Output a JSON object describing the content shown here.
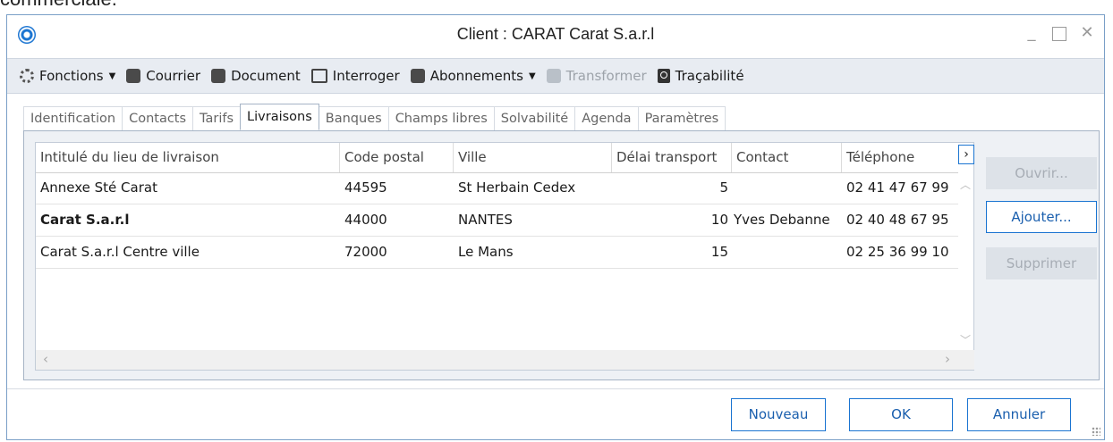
{
  "background_text": "commerciale.",
  "window": {
    "title": "Client : CARAT Carat S.a.r.l",
    "controls": {
      "minimize": "_",
      "close": "✕"
    }
  },
  "toolbar": {
    "items": [
      {
        "label": "Fonctions",
        "icon": "gear-icon",
        "has_dropdown": true,
        "enabled": true
      },
      {
        "label": "Courrier",
        "icon": "letter-icon",
        "has_dropdown": false,
        "enabled": true
      },
      {
        "label": "Document",
        "icon": "document-add-icon",
        "has_dropdown": false,
        "enabled": true
      },
      {
        "label": "Interroger",
        "icon": "query-icon",
        "has_dropdown": false,
        "enabled": true
      },
      {
        "label": "Abonnements",
        "icon": "calendar-icon",
        "has_dropdown": true,
        "enabled": true
      },
      {
        "label": "Transformer",
        "icon": "transform-icon",
        "has_dropdown": false,
        "enabled": false
      },
      {
        "label": "Traçabilité",
        "icon": "search-icon",
        "has_dropdown": false,
        "enabled": true
      }
    ],
    "caret": "▼"
  },
  "tabs": [
    {
      "label": "Identification",
      "active": false
    },
    {
      "label": "Contacts",
      "active": false
    },
    {
      "label": "Tarifs",
      "active": false
    },
    {
      "label": "Livraisons",
      "active": true
    },
    {
      "label": "Banques",
      "active": false
    },
    {
      "label": "Champs libres",
      "active": false
    },
    {
      "label": "Solvabilité",
      "active": false
    },
    {
      "label": "Agenda",
      "active": false
    },
    {
      "label": "Paramètres",
      "active": false
    }
  ],
  "grid": {
    "columns": [
      "Intitulé du lieu de livraison",
      "Code postal",
      "Ville",
      "Délai transport",
      "Contact",
      "Téléphone"
    ],
    "rows": [
      {
        "intitule": "Annexe Sté Carat",
        "code_postal": "44595",
        "ville": "St Herbain Cedex",
        "delai": "5",
        "contact": "",
        "telephone": "02 41 47 67 99",
        "bold": false
      },
      {
        "intitule": "Carat S.a.r.l",
        "code_postal": "44000",
        "ville": "NANTES",
        "delai": "10",
        "contact": "Yves Debanne",
        "telephone": "02 40 48 67 95",
        "bold": true
      },
      {
        "intitule": "Carat S.a.r.l Centre ville",
        "code_postal": "72000",
        "ville": "Le Mans",
        "delai": "15",
        "contact": "",
        "telephone": "02 25 36 99 10",
        "bold": false
      }
    ],
    "scroll_right": "›"
  },
  "side_buttons": {
    "open": "Ouvrir...",
    "add": "Ajouter...",
    "delete": "Supprimer"
  },
  "footer": {
    "new": "Nouveau",
    "ok": "OK",
    "cancel": "Annuler"
  },
  "colors": {
    "accent": "#1a74d1",
    "toolbar_bg": "#e8ecf2",
    "disabled_text": "#a7adb5"
  }
}
